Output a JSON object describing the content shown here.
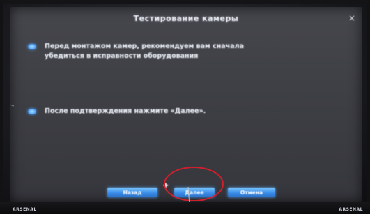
{
  "dialog": {
    "title": "Тестирование камеры",
    "close_glyph": "×",
    "messages": [
      "Перед монтажом камер, рекомендуем вам сначала убедиться в исправности оборудования",
      "После подтверждения нажмите «Далее»."
    ]
  },
  "buttons": {
    "back": "Назад",
    "next": "Далее",
    "cancel": "Отмена"
  },
  "bezel": {
    "brand_left": "ARSENAL",
    "brand_right": "ARSENAL"
  },
  "colors": {
    "dialog_bg": "#3f4046",
    "button_blue": "#3b8eea",
    "highlight_red": "#d01f2c",
    "text": "#e6eaf2"
  }
}
